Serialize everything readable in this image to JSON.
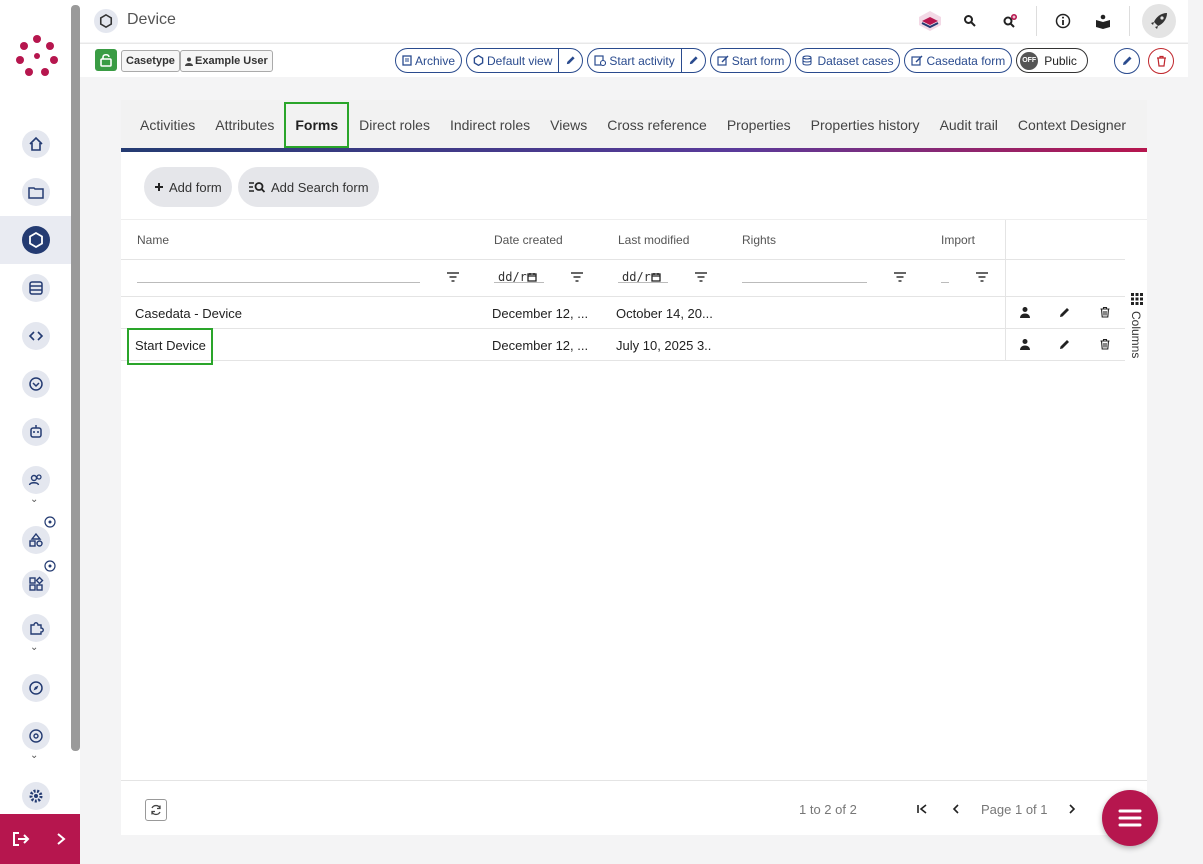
{
  "header": {
    "title": "Device",
    "casetype_tag": "Casetype",
    "user_tag": "Example User"
  },
  "toolbar": {
    "archive": "Archive",
    "default_view": "Default view",
    "start_activity": "Start activity",
    "start_form": "Start form",
    "dataset_cases": "Dataset cases",
    "casedata_form": "Casedata form",
    "toggle_state": "OFF",
    "public": "Public"
  },
  "tabs": [
    {
      "label": "Activities"
    },
    {
      "label": "Attributes"
    },
    {
      "label": "Forms"
    },
    {
      "label": "Direct roles"
    },
    {
      "label": "Indirect roles"
    },
    {
      "label": "Views"
    },
    {
      "label": "Cross reference"
    },
    {
      "label": "Properties"
    },
    {
      "label": "Properties history"
    },
    {
      "label": "Audit trail"
    },
    {
      "label": "Context Designer"
    }
  ],
  "actions": {
    "add_form": "Add form",
    "add_search_form": "Add Search form"
  },
  "table": {
    "headers": {
      "name": "Name",
      "date_created": "Date created",
      "last_modified": "Last modified",
      "rights": "Rights",
      "import": "Import"
    },
    "date_placeholder": "dd/r",
    "rows": [
      {
        "name": "Casedata - Device",
        "created": "December 12, ...",
        "modified": "October 14, 20..."
      },
      {
        "name": "Start Device",
        "created": "December 12, ...",
        "modified": "July 10, 2025 3..."
      }
    ],
    "columns_label": "Columns"
  },
  "pagination": {
    "range": "1 to 2 of 2",
    "page": "Page 1 of 1"
  },
  "colors": {
    "brand_primary": "#243b72",
    "brand_accent": "#b6164e",
    "highlight": "#2aa52a"
  }
}
